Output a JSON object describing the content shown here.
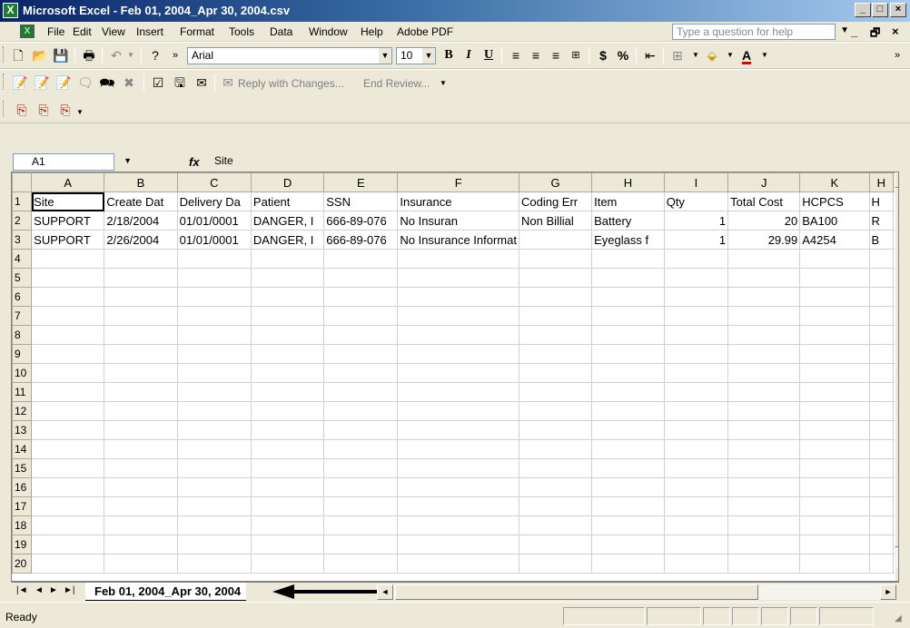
{
  "window": {
    "title": "Microsoft Excel - Feb 01, 2004_Apr 30, 2004.csv",
    "min_glyph": "_",
    "max_glyph": "□",
    "close_glyph": "×"
  },
  "menu": {
    "items": [
      "File",
      "Edit",
      "View",
      "Insert",
      "Format",
      "Tools",
      "Data",
      "Window",
      "Help",
      "Adobe PDF"
    ],
    "help_placeholder": "Type a question for help",
    "doc_min": "_",
    "doc_restore": "🗗",
    "doc_close": "×"
  },
  "toolbar": {
    "font_name": "Arial",
    "font_size": "10",
    "bold": "B",
    "italic": "I",
    "underline": "U",
    "currency": "$",
    "percent": "%",
    "font_color_letter": "A"
  },
  "reviewing": {
    "reply_label": "Reply with Changes...",
    "end_review_label": "End Review..."
  },
  "formula_bar": {
    "cell_ref": "A1",
    "fx": "fx",
    "content": "Site"
  },
  "sheet": {
    "columns": [
      "A",
      "B",
      "C",
      "D",
      "E",
      "F",
      "G",
      "H",
      "I",
      "J",
      "K",
      "H"
    ],
    "rows": [
      [
        "Site",
        "Create Dat",
        "Delivery Da",
        "Patient",
        "SSN",
        "Insurance",
        "Coding Err",
        "Item",
        "Qty",
        "Total Cost",
        "HCPCS",
        "H"
      ],
      [
        "SUPPORT",
        "2/18/2004",
        "01/01/0001",
        "DANGER, I",
        "666-89-076",
        "No Insuran",
        "Non Billial",
        "Battery",
        "1",
        "20",
        "BA100",
        "R"
      ],
      [
        "SUPPORT",
        "2/26/2004",
        "01/01/0001",
        "DANGER, I",
        "666-89-076",
        "No Insurance Informat",
        "",
        "Eyeglass f",
        "1",
        "29.99",
        "A4254",
        "B"
      ]
    ],
    "row_numbers": [
      "1",
      "2",
      "3",
      "4",
      "5",
      "6",
      "7",
      "8",
      "9",
      "10",
      "11",
      "12",
      "13",
      "14",
      "15",
      "16",
      "17",
      "18",
      "19",
      "20"
    ]
  },
  "tabs": {
    "active": "Feb 01, 2004_Apr 30, 2004"
  },
  "status": {
    "text": "Ready"
  }
}
